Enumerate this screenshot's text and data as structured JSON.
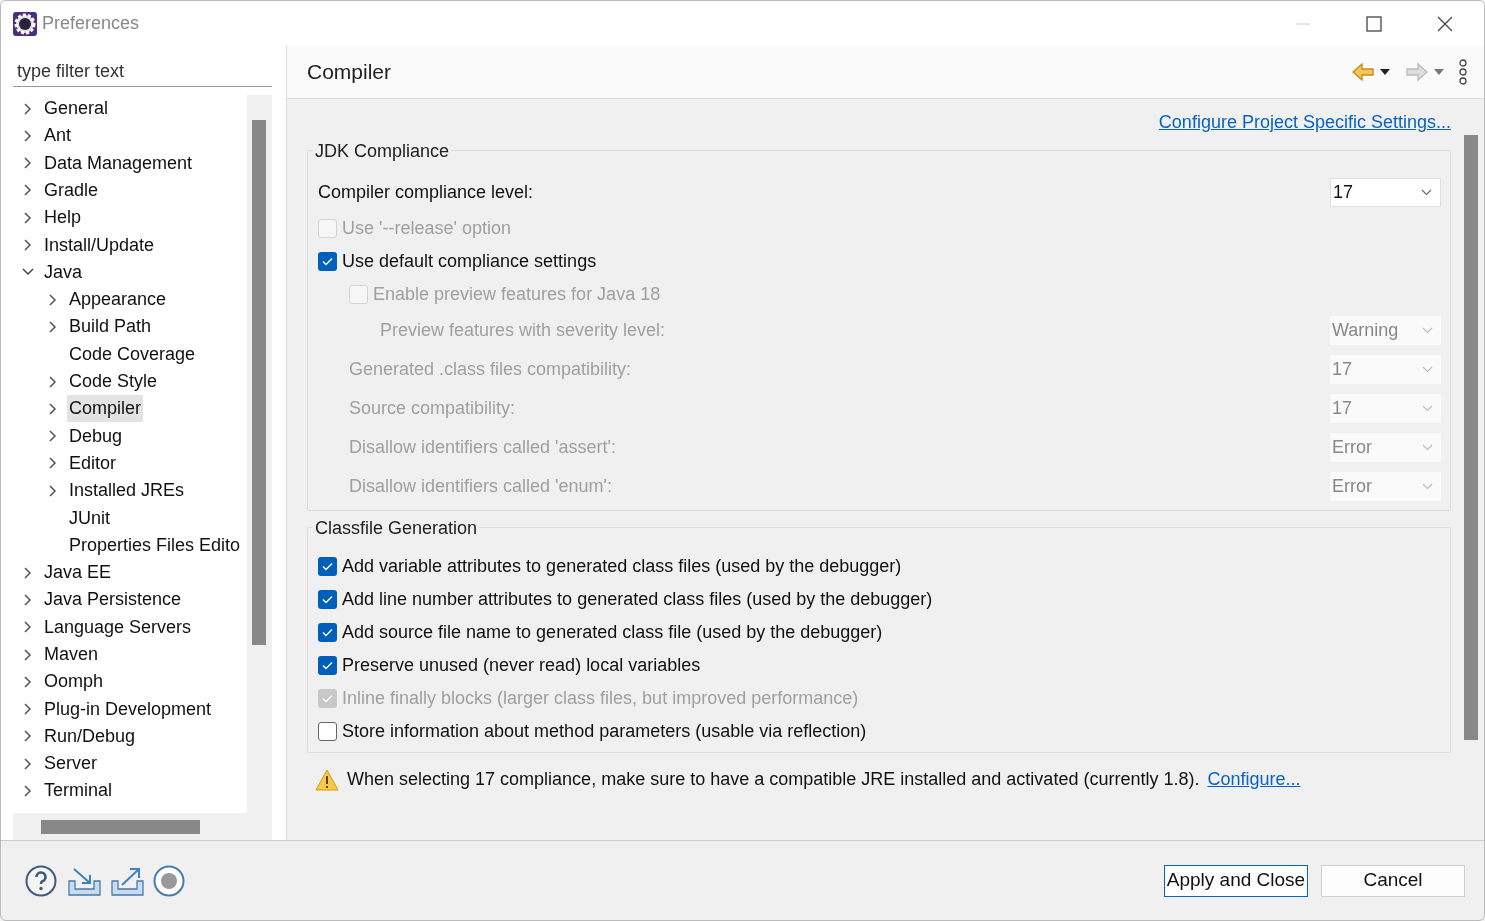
{
  "window": {
    "title": "Preferences"
  },
  "filter": {
    "placeholder": "type filter text"
  },
  "tree": [
    {
      "label": "General",
      "expanded": false,
      "selected": false
    },
    {
      "label": "Ant",
      "expanded": false,
      "selected": false
    },
    {
      "label": "Data Management",
      "expanded": false,
      "selected": false
    },
    {
      "label": "Gradle",
      "expanded": false,
      "selected": false
    },
    {
      "label": "Help",
      "expanded": false,
      "selected": false
    },
    {
      "label": "Install/Update",
      "expanded": false,
      "selected": false
    },
    {
      "label": "Java",
      "expanded": true,
      "selected": false,
      "children": [
        {
          "label": "Appearance",
          "expanded": false,
          "selected": false
        },
        {
          "label": "Build Path",
          "expanded": false,
          "selected": false
        },
        {
          "label": "Code Coverage",
          "selected": false
        },
        {
          "label": "Code Style",
          "expanded": false,
          "selected": false
        },
        {
          "label": "Compiler",
          "expanded": false,
          "selected": true
        },
        {
          "label": "Debug",
          "expanded": false,
          "selected": false
        },
        {
          "label": "Editor",
          "expanded": false,
          "selected": false
        },
        {
          "label": "Installed JREs",
          "expanded": false,
          "selected": false
        },
        {
          "label": "JUnit",
          "selected": false
        },
        {
          "label": "Properties Files Edito",
          "selected": false
        }
      ]
    },
    {
      "label": "Java EE",
      "expanded": false,
      "selected": false
    },
    {
      "label": "Java Persistence",
      "expanded": false,
      "selected": false
    },
    {
      "label": "Language Servers",
      "expanded": false,
      "selected": false
    },
    {
      "label": "Maven",
      "expanded": false,
      "selected": false
    },
    {
      "label": "Oomph",
      "expanded": false,
      "selected": false
    },
    {
      "label": "Plug-in Development",
      "expanded": false,
      "selected": false
    },
    {
      "label": "Run/Debug",
      "expanded": false,
      "selected": false
    },
    {
      "label": "Server",
      "expanded": false,
      "selected": false
    },
    {
      "label": "Terminal",
      "expanded": false,
      "selected": false
    }
  ],
  "page": {
    "title": "Compiler",
    "nav": [
      {
        "kind": "back",
        "disabled": false
      },
      {
        "kind": "forward",
        "disabled": true
      }
    ],
    "link": "Configure Project Specific Settings...",
    "groups": [
      {
        "title": "JDK Compliance",
        "settings": [
          {
            "kind": "select",
            "label": "Compiler compliance level:",
            "value": "17",
            "disabled": false
          },
          {
            "kind": "checkbox",
            "label": "Use '--release' option",
            "checked": false,
            "disabled": true
          },
          {
            "kind": "checkbox",
            "label": "Use default compliance settings",
            "checked": true,
            "disabled": false,
            "children": [
              {
                "kind": "checkbox",
                "label": "Enable preview features for Java 18",
                "checked": false,
                "disabled": true,
                "children": [
                  {
                    "kind": "select",
                    "label": "Preview features with severity level:",
                    "value": "Warning",
                    "disabled": true
                  }
                ]
              },
              {
                "kind": "select",
                "label": "Generated .class files compatibility:",
                "value": "17",
                "disabled": true
              },
              {
                "kind": "select",
                "label": "Source compatibility:",
                "value": "17",
                "disabled": true
              },
              {
                "kind": "select",
                "label": "Disallow identifiers called 'assert':",
                "value": "Error",
                "disabled": true
              },
              {
                "kind": "select",
                "label": "Disallow identifiers called 'enum':",
                "value": "Error",
                "disabled": true
              }
            ]
          }
        ]
      },
      {
        "title": "Classfile Generation",
        "settings": [
          {
            "kind": "checkbox",
            "label": "Add variable attributes to generated class files (used by the debugger)",
            "checked": true,
            "disabled": false
          },
          {
            "kind": "checkbox",
            "label": "Add line number attributes to generated class files (used by the debugger)",
            "checked": true,
            "disabled": false
          },
          {
            "kind": "checkbox",
            "label": "Add source file name to generated class file (used by the debugger)",
            "checked": true,
            "disabled": false
          },
          {
            "kind": "checkbox",
            "label": "Preserve unused (never read) local variables",
            "checked": true,
            "disabled": false
          },
          {
            "kind": "checkbox",
            "label": "Inline finally blocks (larger class files, but improved performance)",
            "checked": true,
            "disabled": true
          },
          {
            "kind": "checkbox",
            "label": "Store information about method parameters (usable via reflection)",
            "checked": false,
            "disabled": false
          }
        ]
      }
    ],
    "warning": {
      "text": "When selecting 17 compliance, make sure to have a compatible JRE installed and activated (currently 1.8).",
      "link": "Configure..."
    }
  },
  "buttons": [
    "Apply and Close",
    "Cancel"
  ]
}
